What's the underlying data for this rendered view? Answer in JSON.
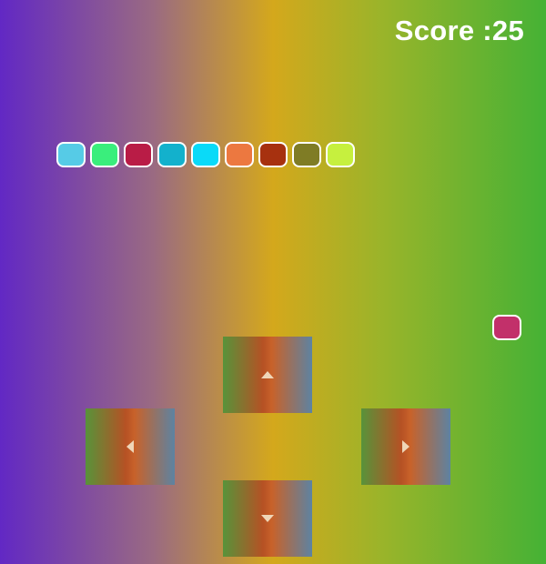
{
  "hud": {
    "score_text": "Score :25"
  },
  "snake": {
    "segments": [
      {
        "color": "#56cbe6"
      },
      {
        "color": "#3aee7c"
      },
      {
        "color": "#b91c46"
      },
      {
        "color": "#13b1cc"
      },
      {
        "color": "#0adaf8"
      },
      {
        "color": "#ec7840"
      },
      {
        "color": "#a7310f"
      },
      {
        "color": "#7f7c25"
      },
      {
        "color": "#c6f03e"
      }
    ]
  },
  "food": {
    "color": "#c2306a"
  },
  "controls": {
    "up_icon": "triangle-up-icon",
    "left_icon": "triangle-left-icon",
    "right_icon": "triangle-right-icon",
    "down_icon": "triangle-down-icon"
  }
}
